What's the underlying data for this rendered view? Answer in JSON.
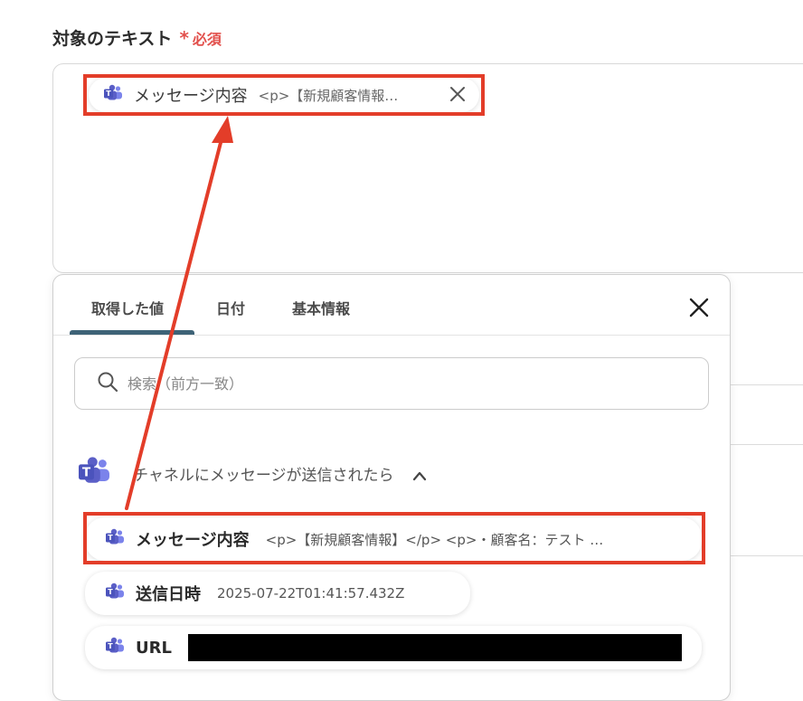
{
  "field": {
    "label": "対象のテキスト",
    "required_star": "*",
    "required_text": "必須"
  },
  "chip": {
    "name": "メッセージ内容",
    "value": "<p>【新規顧客情報…"
  },
  "tabs": [
    {
      "label": "取得した値"
    },
    {
      "label": "日付"
    },
    {
      "label": "基本情報"
    }
  ],
  "search": {
    "placeholder": "検索（前方一致）"
  },
  "group": {
    "title": "チャネルにメッセージが送信されたら"
  },
  "items": [
    {
      "name": "メッセージ内容",
      "value": "<p>【新規顧客情報】</p> <p>・顧客名：テスト …"
    },
    {
      "name": "送信日時",
      "value": "2025-07-22T01:41:57.432Z"
    },
    {
      "name": "URL",
      "value": ""
    }
  ],
  "colors": {
    "accent_red": "#e33d29",
    "tab_underline": "#3e6377",
    "required": "#e2504c",
    "teams_purple": "#5b5fc7"
  },
  "icons": {
    "teams": "teams-icon",
    "close": "close-icon",
    "search": "search-icon",
    "chevron": "chevron-up-icon"
  }
}
